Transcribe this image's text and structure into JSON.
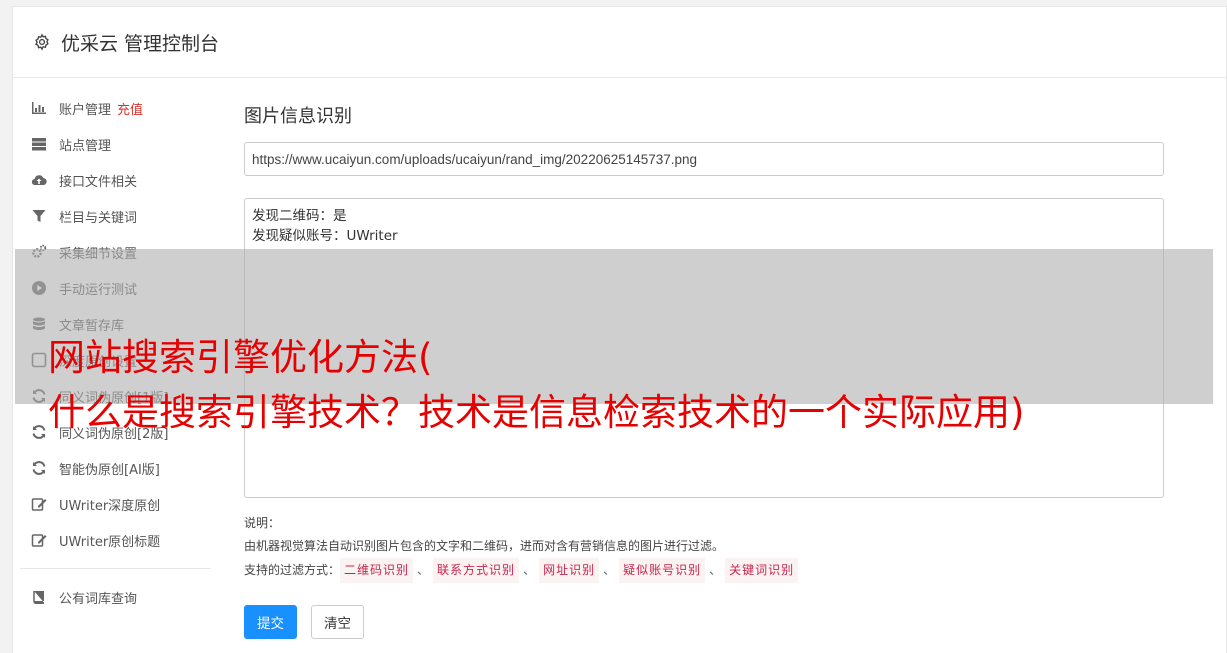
{
  "header": {
    "icon": "gear-icon",
    "title": "优采云 管理控制台"
  },
  "sidebar": {
    "items": [
      {
        "icon": "bar-chart-icon",
        "label": "账户管理",
        "extra": "充值"
      },
      {
        "icon": "server-icon",
        "label": "站点管理"
      },
      {
        "icon": "cloud-upload-icon",
        "label": "接口文件相关"
      },
      {
        "icon": "filter-icon",
        "label": "栏目与关键词"
      },
      {
        "icon": "gears-icon",
        "label": "采集细节设置"
      },
      {
        "icon": "play-circle-icon",
        "label": "手动运行测试"
      },
      {
        "icon": "database-icon",
        "label": "文章暂存库"
      },
      {
        "icon": "checkbox-icon",
        "label": "深度原创设置"
      },
      {
        "icon": "refresh-icon",
        "label": "同义词伪原创[1版]"
      },
      {
        "icon": "refresh-icon",
        "label": "同义词伪原创[2版]"
      },
      {
        "icon": "refresh-icon",
        "label": "智能伪原创[AI版]"
      },
      {
        "icon": "edit-icon",
        "label": "UWriter深度原创"
      },
      {
        "icon": "edit-icon",
        "label": "UWriter原创标题"
      }
    ],
    "bottom_items": [
      {
        "icon": "book-icon",
        "label": "公有词库查询"
      }
    ]
  },
  "main": {
    "title": "图片信息识别",
    "url_value": "https://www.ucaiyun.com/uploads/ucaiyun/rand_img/20220625145737.png",
    "result_text": "发现二维码：是\n发现疑似账号：UWriter",
    "notes_label": "说明：",
    "notes_text": "由机器视觉算法自动识别图片包含的文字和二维码，进而对含有营销信息的图片进行过滤。",
    "filters_label": "支持的过滤方式：",
    "filters": [
      "二维码识别",
      "联系方式识别",
      "网址识别",
      "疑似账号识别",
      "关键词识别"
    ],
    "filter_separator": "、",
    "submit_label": "提交",
    "clear_label": "清空"
  },
  "overlay": {
    "line1": "网站搜索引擎优化方法(",
    "line2": "什么是搜索引擎技术？技术是信息检索技术的一个实际应用)"
  },
  "colors": {
    "accent": "#1890ff",
    "recharge": "#d9342b",
    "tag_text": "#c7254e",
    "headline": "#e60000"
  }
}
